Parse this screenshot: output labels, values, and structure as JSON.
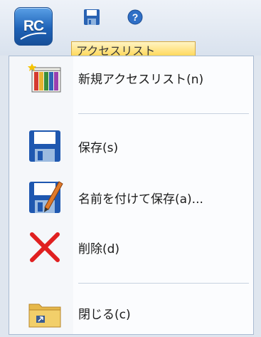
{
  "app": {
    "logo_text": "RC",
    "logo_icon": "app-logo-icon"
  },
  "quick_access": {
    "save_icon": "floppy-disk-icon",
    "help_icon": "help-icon"
  },
  "ribbon": {
    "active_tab": "アクセスリスト"
  },
  "menu": {
    "items": [
      {
        "label": "新規アクセスリスト(n)",
        "icon": "new-book-list-icon"
      },
      {
        "label": "保存(s)",
        "icon": "floppy-disk-icon"
      },
      {
        "label": "名前を付けて保存(a)...",
        "icon": "save-as-icon"
      },
      {
        "label": "削除(d)",
        "icon": "delete-x-icon"
      },
      {
        "label": "閉じる(c)",
        "icon": "close-folder-icon"
      }
    ]
  },
  "colors": {
    "accent": "#1f63b8",
    "highlight_tab": "#ffd95e",
    "delete_red": "#e02020"
  }
}
